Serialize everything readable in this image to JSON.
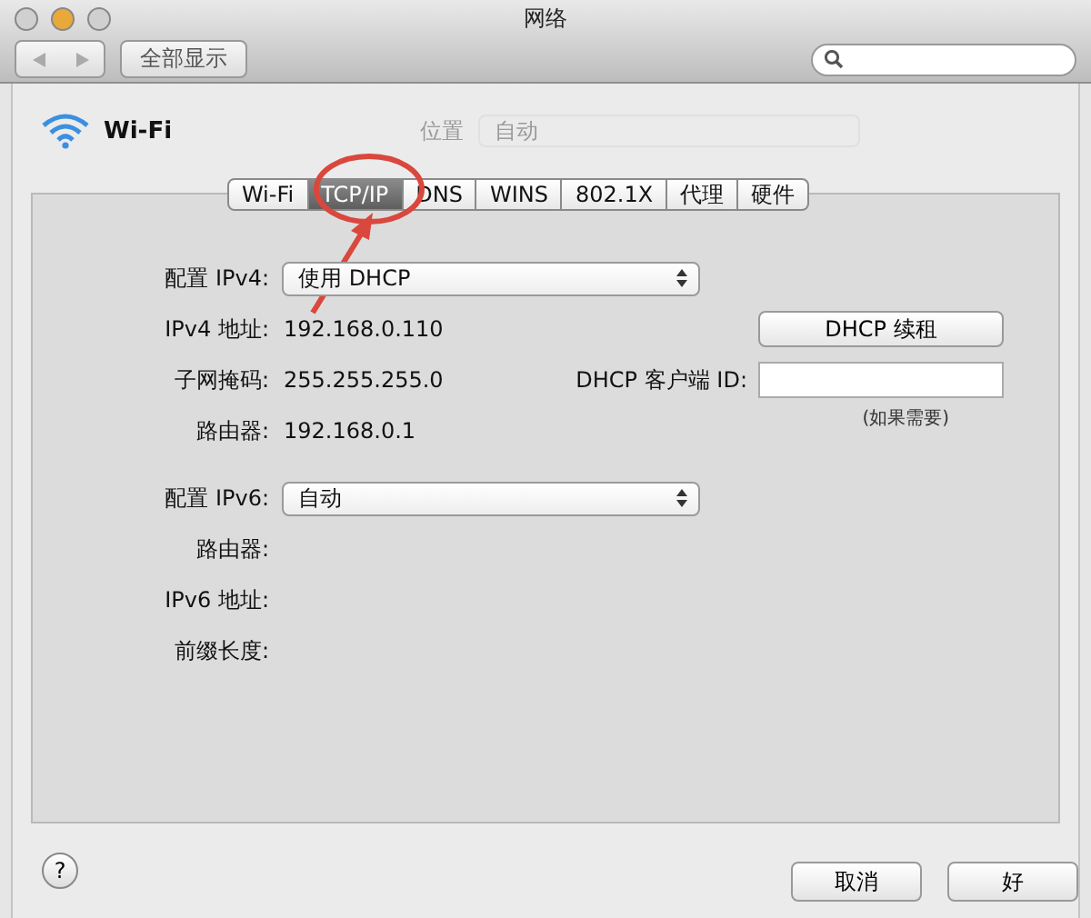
{
  "window": {
    "title": "网络"
  },
  "toolbar": {
    "show_all": "全部显示"
  },
  "service": {
    "name": "Wi-Fi"
  },
  "location": {
    "label": "位置",
    "value": "自动"
  },
  "tabs": [
    {
      "label": "Wi-Fi",
      "selected": false
    },
    {
      "label": "TCP/IP",
      "selected": true
    },
    {
      "label": "DNS",
      "selected": false
    },
    {
      "label": "WINS",
      "selected": false
    },
    {
      "label": "802.1X",
      "selected": false
    },
    {
      "label": "代理",
      "selected": false
    },
    {
      "label": "硬件",
      "selected": false
    }
  ],
  "rows": [
    {
      "kind": "popup",
      "label": "配置 IPv4:",
      "value": "使用 DHCP"
    },
    {
      "kind": "text",
      "label": "IPv4 地址:",
      "value": "192.168.0.110",
      "button": "DHCP 续租"
    },
    {
      "kind": "text",
      "label": "子网掩码:",
      "value": "255.255.255.0",
      "field_label": "DHCP 客户端 ID:",
      "field_note": "(如果需要)"
    },
    {
      "kind": "text",
      "label": "路由器:",
      "value": "192.168.0.1"
    },
    {
      "kind": "popup",
      "label": "配置 IPv6:",
      "value": "自动"
    },
    {
      "kind": "empty",
      "label": "路由器:"
    },
    {
      "kind": "empty",
      "label": "IPv6 地址:"
    },
    {
      "kind": "empty",
      "label": "前缀长度:"
    }
  ],
  "footer": {
    "help": "?",
    "buttons": [
      "取消",
      "好"
    ]
  }
}
